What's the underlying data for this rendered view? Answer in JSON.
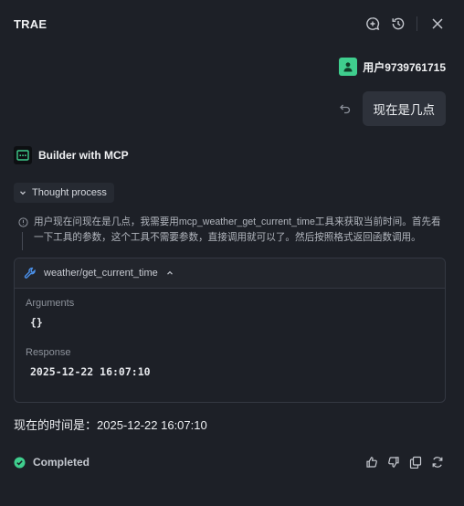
{
  "app": {
    "title": "TRAE"
  },
  "header": {
    "icons": [
      "new-chat-icon",
      "history-icon",
      "close-icon"
    ]
  },
  "user": {
    "name": "用户9739761715",
    "message": "现在是几点"
  },
  "assistant": {
    "name": "Builder with MCP",
    "thought_label": "Thought process",
    "thought_text": "用户现在问现在是几点，我需要用mcp_weather_get_current_time工具来获取当前时间。首先看一下工具的参数，这个工具不需要参数，直接调用就可以了。然后按照格式返回函数调用。",
    "tool": {
      "name": "weather/get_current_time",
      "arguments_label": "Arguments",
      "arguments_value": "{}",
      "response_label": "Response",
      "response_value": "2025-12-22 16:07:10"
    },
    "answer": "现在的时间是：2025-12-22 16:07:10",
    "status": "Completed"
  },
  "footer": {
    "icons": [
      "thumbs-up-icon",
      "thumbs-down-icon",
      "copy-icon",
      "retry-icon"
    ]
  },
  "colors": {
    "background": "#1d2027",
    "accent_green": "#3fce8e",
    "tool_blue": "#4a8fe8"
  }
}
